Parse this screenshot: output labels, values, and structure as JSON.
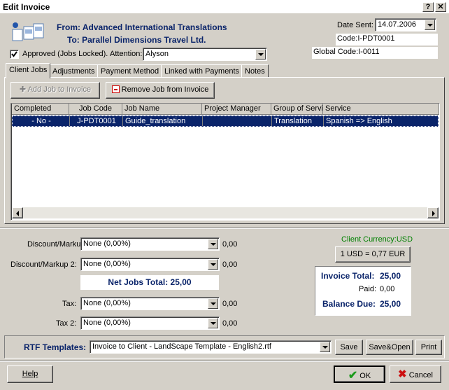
{
  "window": {
    "title": "Edit Invoice",
    "help_btn": "?",
    "close_btn": "X"
  },
  "header": {
    "from_label": "From:",
    "from_value": "Advanced International Translations",
    "to_label": "To:",
    "to_value": "Parallel Dimensions Travel Ltd.",
    "approved_label": "Approved (Jobs Locked).",
    "approved_checked": true,
    "attention_label": "Attention:",
    "attention_value": "Alyson",
    "date_sent_label": "Date Sent:",
    "date_sent_value": "14.07.2006",
    "code": "Code:I-PDT0001",
    "global_code": "Global Code:I-0011"
  },
  "tabs": [
    {
      "label": "Client Jobs",
      "active": true
    },
    {
      "label": "Adjustments"
    },
    {
      "label": "Payment Method"
    },
    {
      "label": "Linked with Payments"
    },
    {
      "label": "Notes"
    }
  ],
  "jobs_toolbar": {
    "add_label": "Add Job to Invoice",
    "remove_label": "Remove Job from Invoice"
  },
  "jobs_table": {
    "columns": [
      "Completed",
      "Job Code",
      "Job Name",
      "Project Manager",
      "Group of Servi",
      "Service"
    ],
    "rows": [
      {
        "completed": "- No -",
        "job_code": "J-PDT0001",
        "job_name": "Guide_translation",
        "project_manager": "",
        "group": "Translation",
        "service": "Spanish => English"
      }
    ]
  },
  "totals": {
    "discount_label": "Discount/Markup:",
    "discount_value": "None (0,00%)",
    "discount_amount": "0,00",
    "discount2_label": "Discount/Markup 2:",
    "discount2_value": "None (0,00%)",
    "discount2_amount": "0,00",
    "net_jobs_total": "Net Jobs Total: 25,00",
    "tax_label": "Tax:",
    "tax_value": "None (0,00%)",
    "tax_amount": "0,00",
    "tax2_label": "Tax 2:",
    "tax2_value": "None (0,00%)",
    "tax2_amount": "0,00",
    "client_currency": "Client Currency:USD",
    "exchange_rate": "1 USD = 0,77 EUR",
    "invoice_total_label": "Invoice Total:",
    "invoice_total_value": "25,00",
    "paid_label": "Paid:",
    "paid_value": "0,00",
    "balance_due_label": "Balance Due:",
    "balance_due_value": "25,00"
  },
  "rtf": {
    "label": "RTF Templates:",
    "value": "Invoice to Client - LandScape Template - English2.rtf",
    "save": "Save",
    "save_open": "Save&Open",
    "print": "Print"
  },
  "footer": {
    "help": "Help",
    "ok": "OK",
    "cancel": "Cancel"
  },
  "colors": {
    "selection": "#0a246a",
    "currency_green": "#008000",
    "navy_text": "#0a246a"
  }
}
